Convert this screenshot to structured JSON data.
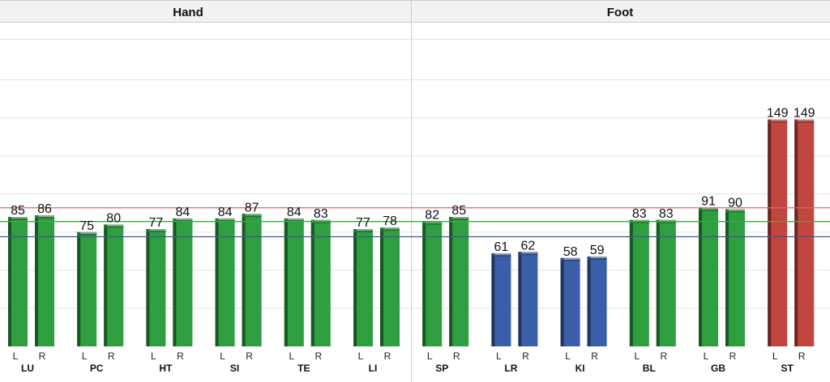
{
  "chart_data": {
    "type": "bar",
    "sections": [
      {
        "name": "Hand",
        "groups": [
          "LU",
          "PC",
          "HT",
          "SI",
          "TE",
          "LI"
        ]
      },
      {
        "name": "Foot",
        "groups": [
          "SP",
          "LR",
          "KI",
          "BL",
          "GB",
          "ST"
        ]
      }
    ],
    "sides": [
      "L",
      "R"
    ],
    "groups": [
      {
        "name": "LU",
        "L": 85,
        "R": 86,
        "color": "#2e9e41"
      },
      {
        "name": "PC",
        "L": 75,
        "R": 80,
        "color": "#2e9e41"
      },
      {
        "name": "HT",
        "L": 77,
        "R": 84,
        "color": "#2e9e41"
      },
      {
        "name": "SI",
        "L": 84,
        "R": 87,
        "color": "#2e9e41"
      },
      {
        "name": "TE",
        "L": 84,
        "R": 83,
        "color": "#2e9e41"
      },
      {
        "name": "LI",
        "L": 77,
        "R": 78,
        "color": "#2e9e41"
      },
      {
        "name": "SP",
        "L": 82,
        "R": 85,
        "color": "#2e9e41"
      },
      {
        "name": "LR",
        "L": 61,
        "R": 62,
        "color": "#3a5fa8"
      },
      {
        "name": "KI",
        "L": 58,
        "R": 59,
        "color": "#3a5fa8"
      },
      {
        "name": "BL",
        "L": 83,
        "R": 83,
        "color": "#2e9e41"
      },
      {
        "name": "GB",
        "L": 91,
        "R": 90,
        "color": "#2e9e41"
      },
      {
        "name": "ST",
        "L": 149,
        "R": 149,
        "color": "#c0463e"
      }
    ],
    "reference_lines": [
      {
        "value": 91,
        "color": "#e06464"
      },
      {
        "value": 82,
        "color": "#3fa84a"
      },
      {
        "value": 72,
        "color": "#3c5a86"
      }
    ],
    "ylim": [
      0,
      175
    ],
    "grid": true,
    "colors": {
      "normal": "#2e9e41",
      "low": "#3a5fa8",
      "high": "#c0463e"
    }
  }
}
